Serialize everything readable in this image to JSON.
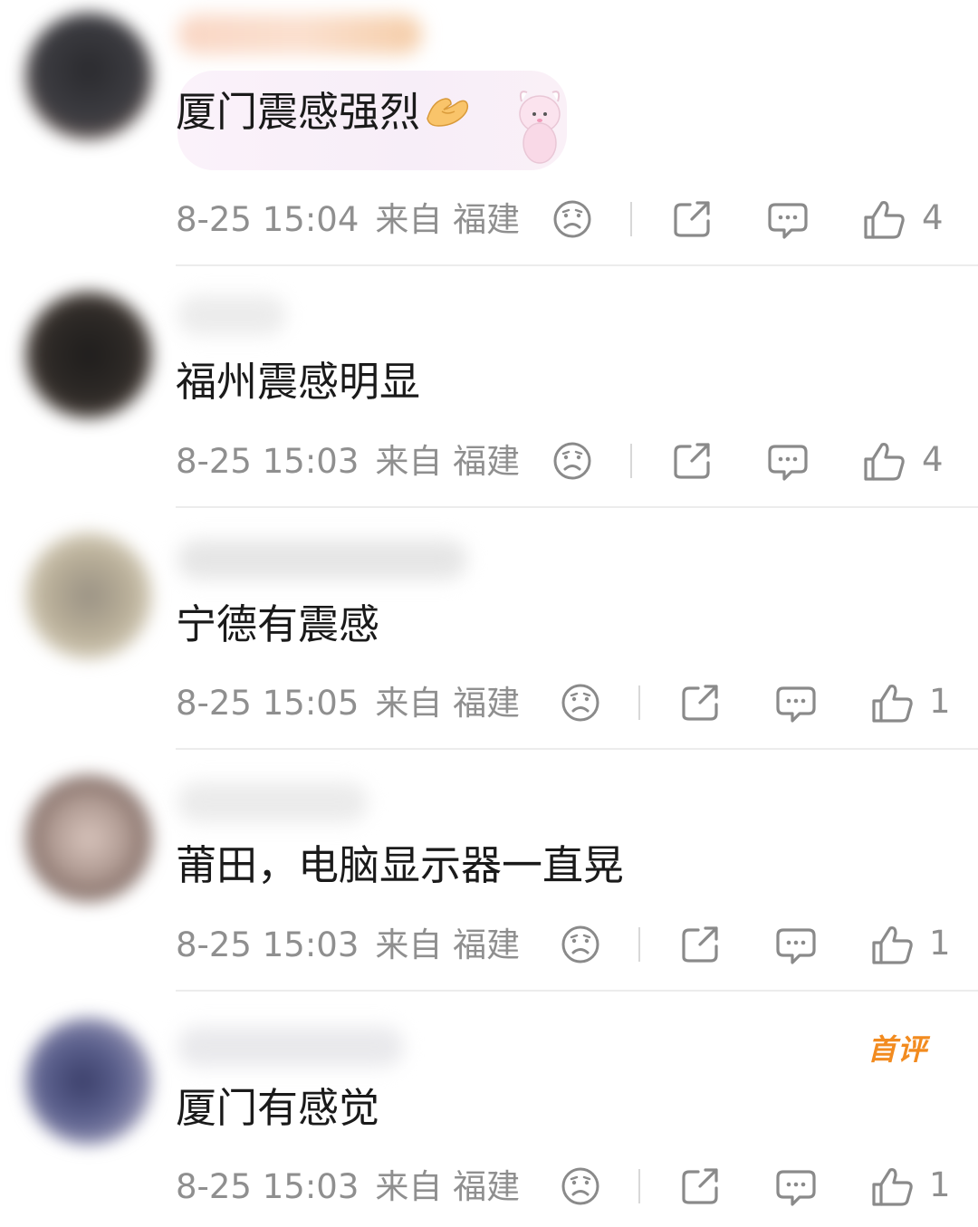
{
  "comments": [
    {
      "text": "厦门震感强烈",
      "time": "8-25 15:04",
      "location": "来自 福建",
      "likes": "4",
      "has_hand_emoji": true,
      "has_sticker": true,
      "first_comment_badge": ""
    },
    {
      "text": "福州震感明显",
      "time": "8-25 15:03",
      "location": "来自 福建",
      "likes": "4",
      "has_hand_emoji": false,
      "has_sticker": false,
      "first_comment_badge": ""
    },
    {
      "text": "宁德有震感",
      "time": "8-25 15:05",
      "location": "来自 福建",
      "likes": "1",
      "has_hand_emoji": false,
      "has_sticker": false,
      "first_comment_badge": ""
    },
    {
      "text": "莆田，电脑显示器一直晃",
      "time": "8-25 15:03",
      "location": "来自 福建",
      "likes": "1",
      "has_hand_emoji": false,
      "has_sticker": false,
      "first_comment_badge": ""
    },
    {
      "text": "厦门有感觉",
      "time": "8-25 15:03",
      "location": "来自 福建",
      "likes": "1",
      "has_hand_emoji": false,
      "has_sticker": false,
      "first_comment_badge": "首评"
    }
  ],
  "icons": {
    "dislike": "sad-face-icon",
    "share": "share-icon",
    "reply": "comment-bubble-icon",
    "like": "thumbs-up-icon"
  },
  "colors": {
    "text": "#1a1a1a",
    "meta": "#8f8f8f",
    "icon": "#8a8a8a",
    "badge": "#f28b1f"
  }
}
